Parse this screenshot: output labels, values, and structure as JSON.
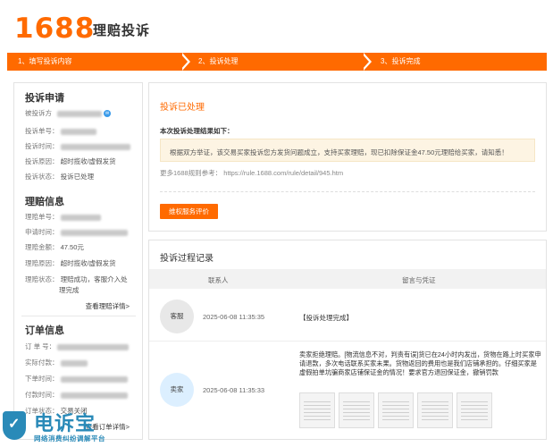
{
  "header": {
    "logo": "1688",
    "title": "理赔投诉"
  },
  "steps": [
    {
      "label": "1、填写投诉内容"
    },
    {
      "label": "2、投诉处理"
    },
    {
      "label": "3、投诉完成"
    }
  ],
  "complaint": {
    "title": "投诉申请",
    "rows": [
      {
        "label": "被投诉方",
        "value": ""
      },
      {
        "label": "投诉单号：",
        "value": ""
      },
      {
        "label": "投诉时间：",
        "value": ""
      },
      {
        "label": "投诉原因：",
        "value": "超时揽收/虚假发货"
      },
      {
        "label": "投诉状态：",
        "value": "投诉已处理"
      }
    ]
  },
  "claim": {
    "title": "理赔信息",
    "rows": [
      {
        "label": "理赔单号：",
        "value": ""
      },
      {
        "label": "申请时间：",
        "value": ""
      },
      {
        "label": "理赔金额：",
        "value": "47.50元"
      },
      {
        "label": "理赔原因：",
        "value": "超时揽收/虚假发货"
      },
      {
        "label": "理赔状态：",
        "value": "理赔成功，客服介入处"
      },
      {
        "label": "",
        "value": "理完成"
      }
    ],
    "detail_link": "查看理赔详情>"
  },
  "order": {
    "title": "订单信息",
    "rows": [
      {
        "label": "订 单 号：",
        "value": ""
      },
      {
        "label": "实际付款：",
        "value": ""
      },
      {
        "label": "下单时间：",
        "value": ""
      },
      {
        "label": "付款时间：",
        "value": ""
      },
      {
        "label": "订单状态：",
        "value": "交易关闭"
      }
    ],
    "detail_link": "查看订单详情>"
  },
  "result": {
    "title": "投诉已处理",
    "subtitle": "本次投诉处理结果如下：",
    "notice": "根据双方举证，该交易买家投诉您方发货问题成立，支持买家理赔，现已扣除保证金47.50元理赔给买家，请知悉！",
    "rule_label": "更多1688规则参考：",
    "rule_url": "https://rule.1688.com/rule/detail/945.htm",
    "rate_button": "维权服务评价"
  },
  "process": {
    "title": "投诉过程记录",
    "col_contact": "联系人",
    "col_message": "留言与凭证",
    "records": [
      {
        "avatar": "客服",
        "time": "2025-06-08 11:35:35",
        "message": "【投诉处理完成】"
      },
      {
        "avatar": "卖家",
        "time": "2025-06-08 11:35:33",
        "message": "卖家拒绝理赔。[物流信息不对，判责有误]货已在24小时内发出，货物在路上时买家申请退款，多次电话联系买家未果。货物返回的费用也是我们店铺承担的。仔细买家是虚假拍单坑骗商家店铺保证金的情况！要求官方退回保证金，撤销罚款"
      }
    ]
  },
  "watermark": {
    "title": "电诉宝",
    "subtitle": "网络消费纠纷调解平台"
  },
  "colors": {
    "accent": "#ff6a00",
    "notice_bg": "#fdf4e3",
    "watermark": "#2a8ab8"
  }
}
